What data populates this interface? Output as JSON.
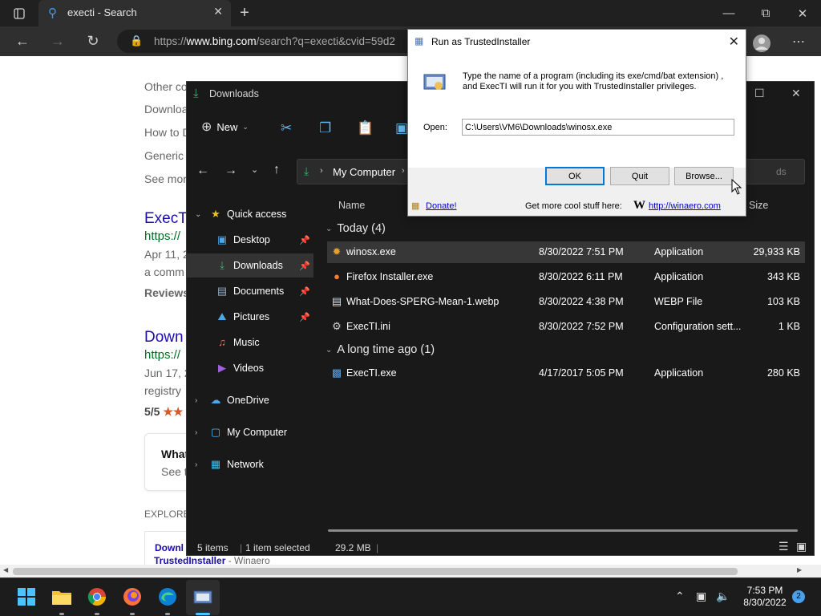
{
  "browser": {
    "tab_title": "execti - Search",
    "url_prefix": "https://",
    "url_domain": "www.bing.com",
    "url_rest": "/search?q=execti&cvid=59d2"
  },
  "webpage": {
    "snippets": [
      "Other co",
      "Downloa",
      "How to D",
      "Generic",
      "See mor"
    ],
    "result1_title": "ExecT",
    "result1_url": "https://",
    "result1_date": "Apr 11, 2",
    "result1_desc": "a comm",
    "result1_reviews": "Reviews",
    "result2_title": "Down",
    "result2_url": "https://",
    "result2_date": "Jun 17, 2",
    "result2_desc": "registry",
    "result2_rating": "5/5",
    "card_title": "What",
    "card_sub": "See t",
    "explore": "EXPLORE",
    "bottom_link1": "Downl",
    "bottom_link2": "TrustedInstaller",
    "bottom_link_site": " - Winaero"
  },
  "explorer": {
    "title": "Downloads",
    "new_label": "New",
    "breadcrumb": "My Computer",
    "search_placeholder": "ds",
    "columns": {
      "name": "Name",
      "size": "Size"
    },
    "sidebar": [
      {
        "label": "Quick access",
        "icon": "star-icon"
      },
      {
        "label": "Desktop",
        "icon": "desktop-icon"
      },
      {
        "label": "Downloads",
        "icon": "download-icon"
      },
      {
        "label": "Documents",
        "icon": "document-icon"
      },
      {
        "label": "Pictures",
        "icon": "picture-icon"
      },
      {
        "label": "Music",
        "icon": "music-icon"
      },
      {
        "label": "Videos",
        "icon": "video-icon"
      },
      {
        "label": "OneDrive",
        "icon": "cloud-icon"
      },
      {
        "label": "My Computer",
        "icon": "computer-icon"
      },
      {
        "label": "Network",
        "icon": "network-icon"
      }
    ],
    "groups": [
      {
        "label": "Today (4)",
        "files": [
          {
            "name": "winosx.exe",
            "date": "8/30/2022 7:51 PM",
            "type": "Application",
            "size": "29,933 KB"
          },
          {
            "name": "Firefox Installer.exe",
            "date": "8/30/2022 6:11 PM",
            "type": "Application",
            "size": "343 KB"
          },
          {
            "name": "What-Does-SPERG-Mean-1.webp",
            "date": "8/30/2022 4:38 PM",
            "type": "WEBP File",
            "size": "103 KB"
          },
          {
            "name": "ExecTI.ini",
            "date": "8/30/2022 7:52 PM",
            "type": "Configuration sett...",
            "size": "1 KB"
          }
        ]
      },
      {
        "label": "A long time ago (1)",
        "files": [
          {
            "name": "ExecTI.exe",
            "date": "4/17/2017 5:05 PM",
            "type": "Application",
            "size": "280 KB"
          }
        ]
      }
    ],
    "status": {
      "items": "5 items",
      "selected": "1 item selected",
      "size": "29.2 MB"
    }
  },
  "dialog": {
    "title": "Run as TrustedInstaller",
    "description_line1": "Type the name of a program (including its exe/cmd/bat extension) ,",
    "description_line2": "and ExecTI will run it for you with TrustedInstaller privileges.",
    "open_label": "Open:",
    "open_value": "C:\\Users\\VM6\\Downloads\\winosx.exe",
    "ok_label": "OK",
    "quit_label": "Quit",
    "browse_label": "Browse...",
    "donate_label": "Donate!",
    "more_text": "Get more cool stuff here:",
    "winaero_link": "http://winaero.com"
  },
  "taskbar": {
    "time": "7:53 PM",
    "date": "8/30/2022",
    "notification_count": "2"
  }
}
